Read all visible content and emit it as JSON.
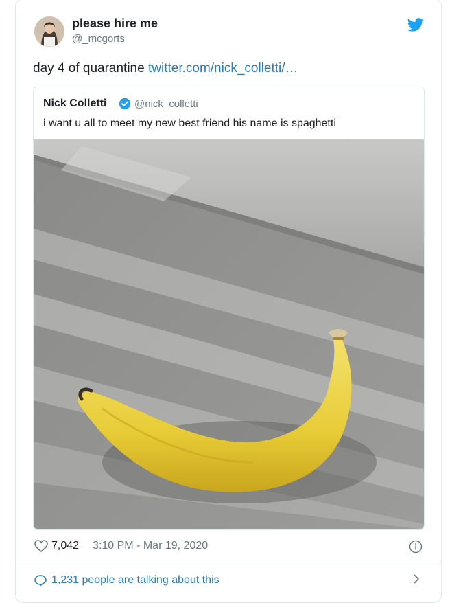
{
  "tweet": {
    "author_name": "please hire me",
    "author_handle": "@_mcgorts",
    "text": "day 4 of quarantine ",
    "link_text": "twitter.com/nick_colletti/…",
    "likes": "7,042",
    "timestamp": "3:10 PM - Mar 19, 2020",
    "conversation": "1,231 people are talking about this"
  },
  "quoted": {
    "author_name": "Nick Colletti",
    "author_handle": "@nick_colletti",
    "text": "i want u all to meet my new best friend his name is spaghetti"
  },
  "colors": {
    "twitter_blue": "#1da1f2",
    "link": "#2b7bb9",
    "secondary_text": "#697882",
    "border": "#e1e8ed"
  },
  "icons": [
    "twitter-bird-icon",
    "verified-badge-icon",
    "heart-icon",
    "info-icon",
    "comment-bubble-icon",
    "chevron-right-icon"
  ]
}
